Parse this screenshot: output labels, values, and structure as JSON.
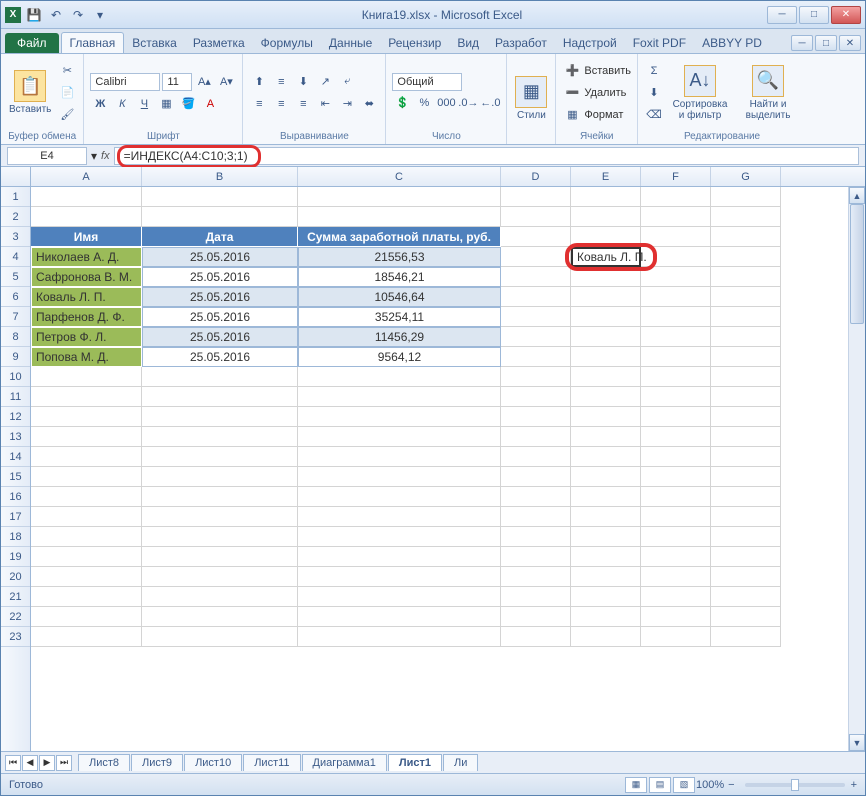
{
  "title": "Книга19.xlsx - Microsoft Excel",
  "qat": {
    "save": "💾",
    "undo": "↶",
    "redo": "↷"
  },
  "tabs": {
    "file": "Файл",
    "items": [
      "Главная",
      "Вставка",
      "Разметка",
      "Формулы",
      "Данные",
      "Рецензир",
      "Вид",
      "Разработ",
      "Надстрой",
      "Foxit PDF",
      "ABBYY PD"
    ],
    "active": 0
  },
  "ribbon": {
    "clipboard": {
      "paste": "Вставить",
      "label": "Буфер обмена"
    },
    "font": {
      "name": "Calibri",
      "size": "11",
      "label": "Шрифт"
    },
    "alignment": {
      "label": "Выравнивание"
    },
    "number": {
      "format": "Общий",
      "label": "Число"
    },
    "styles": {
      "btn": "Стили",
      "label": ""
    },
    "cells": {
      "insert": "Вставить",
      "delete": "Удалить",
      "format": "Формат",
      "label": "Ячейки"
    },
    "editing": {
      "sort": "Сортировка и фильтр",
      "find": "Найти и выделить",
      "label": "Редактирование"
    }
  },
  "formula_bar": {
    "name_box": "E4",
    "fx": "fx",
    "formula": "=ИНДЕКС(A4:C10;3;1)"
  },
  "columns": [
    "A",
    "B",
    "C",
    "D",
    "E",
    "F",
    "G"
  ],
  "rows_visible": 23,
  "table": {
    "headers": [
      "Имя",
      "Дата",
      "Сумма заработной платы, руб."
    ],
    "rows": [
      [
        "Николаев А. Д.",
        "25.05.2016",
        "21556,53"
      ],
      [
        "Сафронова В. М.",
        "25.05.2016",
        "18546,21"
      ],
      [
        "Коваль Л. П.",
        "25.05.2016",
        "10546,64"
      ],
      [
        "Парфенов Д. Ф.",
        "25.05.2016",
        "35254,11"
      ],
      [
        "Петров Ф. Л.",
        "25.05.2016",
        "11456,29"
      ],
      [
        "Попова М. Д.",
        "25.05.2016",
        "9564,12"
      ]
    ]
  },
  "result_cell": {
    "value": "Коваль Л. П."
  },
  "sheet_tabs": [
    "Лист8",
    "Лист9",
    "Лист10",
    "Лист11",
    "Диаграмма1",
    "Лист1",
    "Ли"
  ],
  "active_sheet": 5,
  "status": {
    "ready": "Готово",
    "zoom": "100%"
  }
}
